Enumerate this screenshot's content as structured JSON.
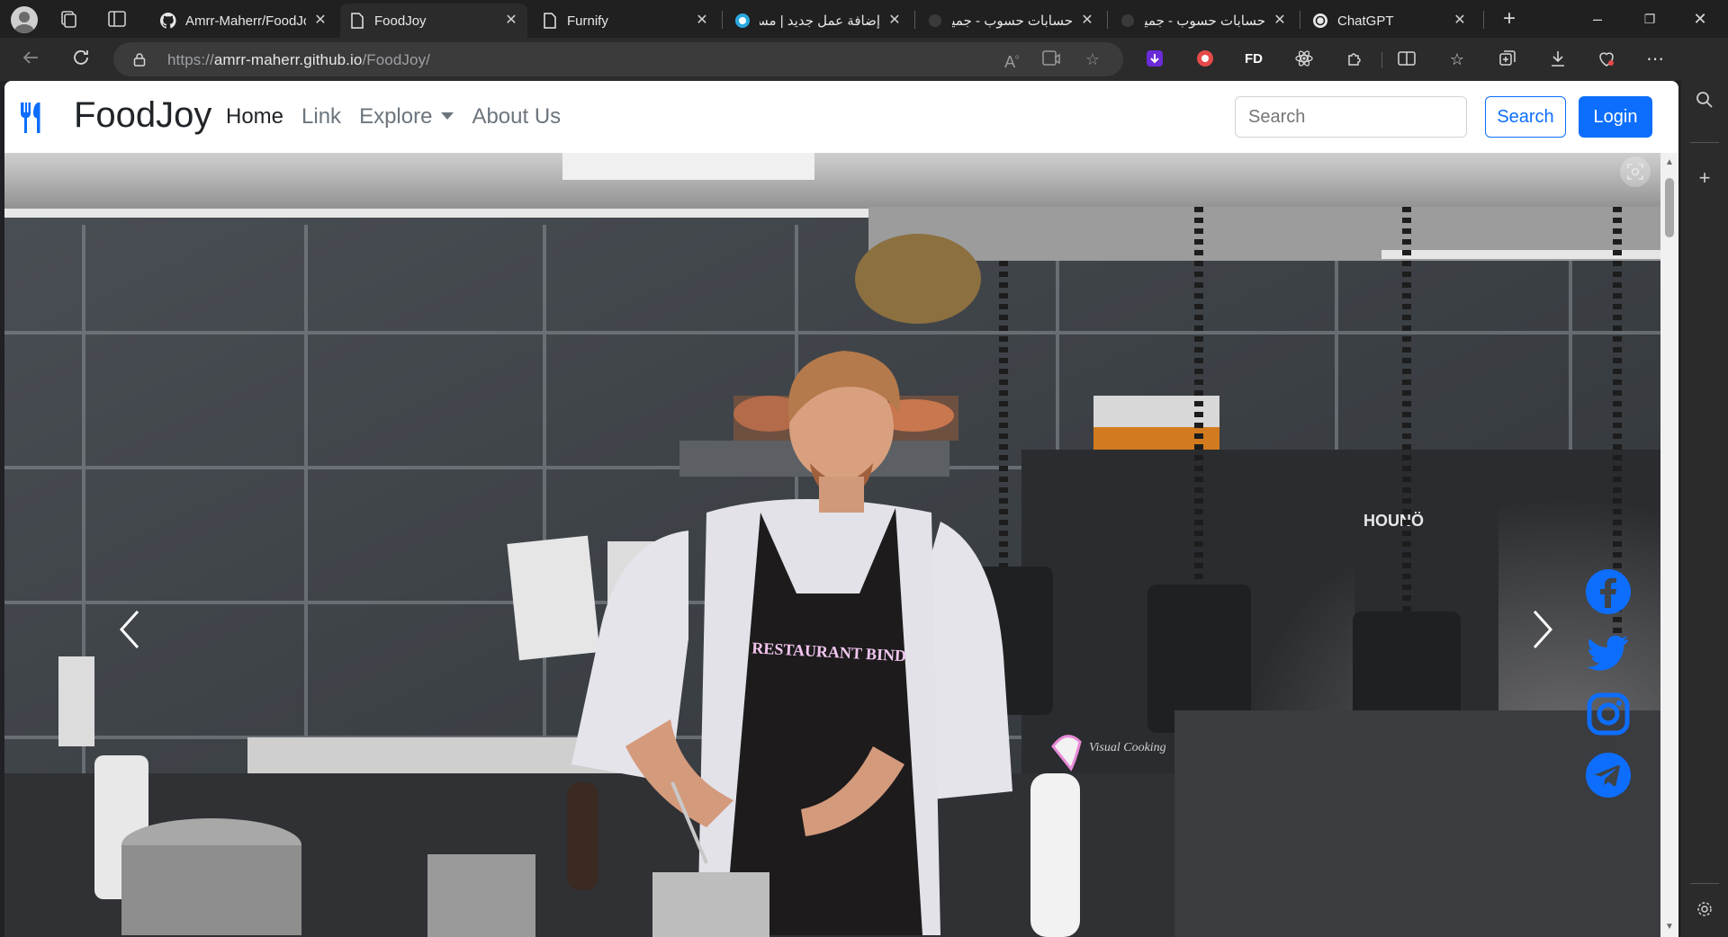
{
  "browser": {
    "tabs": [
      {
        "title": "Amrr-Maherr/FoodJoy",
        "favicon": "github-icon"
      },
      {
        "title": "FoodJoy",
        "favicon": "page-icon",
        "active": true
      },
      {
        "title": "Furnify",
        "favicon": "page-icon"
      },
      {
        "title": "إضافة عمل جديد | مستقل",
        "favicon": "mostaql-icon"
      },
      {
        "title": "حسابات حسوب - جميع",
        "favicon": "hsoub-icon"
      },
      {
        "title": "حسابات حسوب - جميع",
        "favicon": "hsoub-icon"
      },
      {
        "title": "ChatGPT",
        "favicon": "chatgpt-icon"
      }
    ],
    "address": {
      "prefix": "https://",
      "host": "amrr-maherr.github.io",
      "path": "/FoodJoy/"
    },
    "extensions": [
      "download-extension-icon",
      "record-extension-icon",
      "FD",
      "react-devtools-icon",
      "extensions-icon"
    ]
  },
  "page": {
    "brand": "FoodJoy",
    "nav": {
      "home": "Home",
      "link": "Link",
      "explore": "Explore",
      "about": "About Us"
    },
    "search": {
      "placeholder": "Search",
      "button": "Search"
    },
    "login": "Login",
    "hero": {
      "apron_text": "RESTAURANT BIND",
      "sign_text": "HOUNÖ",
      "oven_text": "Visual Cooking"
    },
    "social": [
      "facebook-icon",
      "twitter-icon",
      "instagram-icon",
      "telegram-icon"
    ],
    "colors": {
      "primary": "#0d6efd"
    }
  }
}
